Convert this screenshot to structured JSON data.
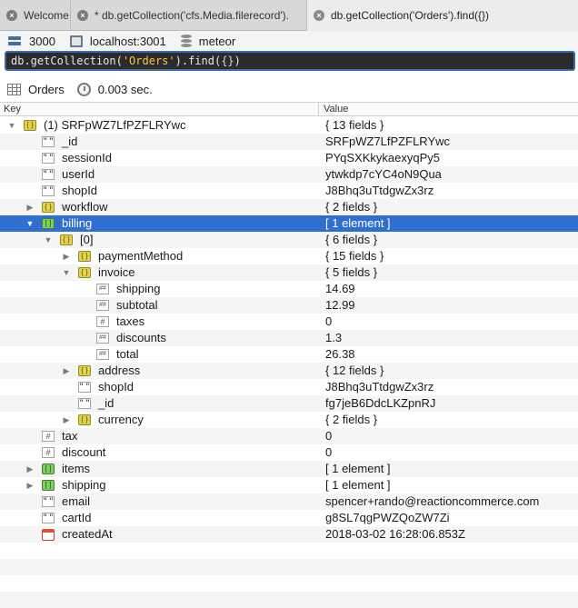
{
  "tabs": [
    {
      "label": "Welcome",
      "active": false
    },
    {
      "label": "* db.getCollection('cfs.Media.filerecord').",
      "active": false
    },
    {
      "label": "db.getCollection('Orders').find({})",
      "active": true
    }
  ],
  "connection": {
    "port": "3000",
    "host": "localhost:3001",
    "database": "meteor"
  },
  "query": {
    "prefix": "db.getCollection(",
    "collection": "'Orders'",
    "middle": ").find(",
    "filter": "{}",
    "suffix": ")"
  },
  "result_info": {
    "collection": "Orders",
    "time": "0.003 sec."
  },
  "columns": {
    "key": "Key",
    "value": "Value"
  },
  "rows": [
    {
      "key": "(1) SRFpWZ7LfPZFLRYwc",
      "value": "{ 13 fields }",
      "type": "obj",
      "depth": 0,
      "tri": "open"
    },
    {
      "key": "_id",
      "value": "SRFpWZ7LfPZFLRYwc",
      "type": "str",
      "depth": 1,
      "tri": ""
    },
    {
      "key": "sessionId",
      "value": "PYqSXKkykaexyqPy5",
      "type": "str",
      "depth": 1,
      "tri": ""
    },
    {
      "key": "userId",
      "value": "ytwkdp7cYC4oN9Qua",
      "type": "str",
      "depth": 1,
      "tri": ""
    },
    {
      "key": "shopId",
      "value": "J8Bhq3uTtdgwZx3rz",
      "type": "str",
      "depth": 1,
      "tri": ""
    },
    {
      "key": "workflow",
      "value": "{ 2 fields }",
      "type": "obj",
      "depth": 1,
      "tri": "closed"
    },
    {
      "key": "billing",
      "value": "[ 1 element ]",
      "type": "arr",
      "depth": 1,
      "tri": "open",
      "selected": true
    },
    {
      "key": "[0]",
      "value": "{ 6 fields }",
      "type": "obj",
      "depth": 2,
      "tri": "open"
    },
    {
      "key": "paymentMethod",
      "value": "{ 15 fields }",
      "type": "obj",
      "depth": 3,
      "tri": "closed"
    },
    {
      "key": "invoice",
      "value": "{ 5 fields }",
      "type": "obj",
      "depth": 3,
      "tri": "open"
    },
    {
      "key": "shipping",
      "value": "14.69",
      "type": "num",
      "depth": 4,
      "tri": ""
    },
    {
      "key": "subtotal",
      "value": "12.99",
      "type": "num",
      "depth": 4,
      "tri": ""
    },
    {
      "key": "taxes",
      "value": "0",
      "type": "int",
      "depth": 4,
      "tri": ""
    },
    {
      "key": "discounts",
      "value": "1.3",
      "type": "num",
      "depth": 4,
      "tri": ""
    },
    {
      "key": "total",
      "value": "26.38",
      "type": "num",
      "depth": 4,
      "tri": ""
    },
    {
      "key": "address",
      "value": "{ 12 fields }",
      "type": "obj",
      "depth": 3,
      "tri": "closed"
    },
    {
      "key": "shopId",
      "value": "J8Bhq3uTtdgwZx3rz",
      "type": "str",
      "depth": 3,
      "tri": ""
    },
    {
      "key": "_id",
      "value": "fg7jeB6DdcLKZpnRJ",
      "type": "str",
      "depth": 3,
      "tri": ""
    },
    {
      "key": "currency",
      "value": "{ 2 fields }",
      "type": "obj",
      "depth": 3,
      "tri": "closed"
    },
    {
      "key": "tax",
      "value": "0",
      "type": "int",
      "depth": 1,
      "tri": ""
    },
    {
      "key": "discount",
      "value": "0",
      "type": "int",
      "depth": 1,
      "tri": ""
    },
    {
      "key": "items",
      "value": "[ 1 element ]",
      "type": "arr",
      "depth": 1,
      "tri": "closed"
    },
    {
      "key": "shipping",
      "value": "[ 1 element ]",
      "type": "arr",
      "depth": 1,
      "tri": "closed"
    },
    {
      "key": "email",
      "value": "spencer+rando@reactioncommerce.com",
      "type": "str",
      "depth": 1,
      "tri": ""
    },
    {
      "key": "cartId",
      "value": "g8SL7qgPWZQoZW7Zi",
      "type": "str",
      "depth": 1,
      "tri": ""
    },
    {
      "key": "createdAt",
      "value": "2018-03-02 16:28:06.853Z",
      "type": "date",
      "depth": 1,
      "tri": ""
    }
  ]
}
